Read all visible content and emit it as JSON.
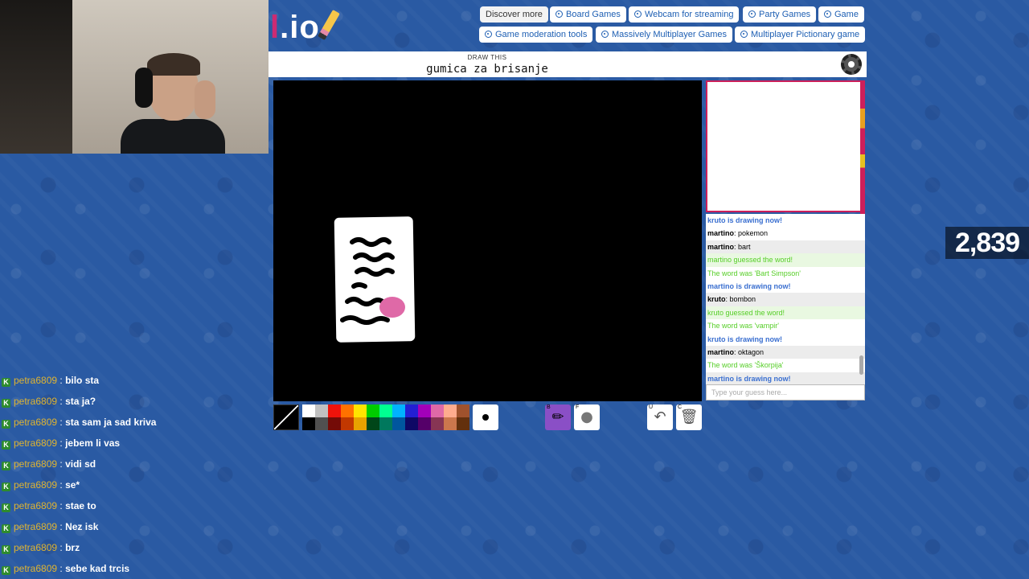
{
  "logo": {
    "part1": "l",
    "part2": ".io"
  },
  "top_links": [
    {
      "label": "Discover more"
    },
    {
      "label": "Board Games"
    },
    {
      "label": "Webcam for streaming"
    },
    {
      "label": "Party Games"
    },
    {
      "label": "Game"
    },
    {
      "label": "Game moderation tools"
    },
    {
      "label": "Massively Multiplayer Games"
    },
    {
      "label": "Multiplayer Pictionary game"
    }
  ],
  "header": {
    "draw_this_label": "DRAW THIS",
    "word": "gumica za brisanje"
  },
  "score": "2,839",
  "chat": {
    "messages": [
      {
        "text": "kruto is drawing now!",
        "kind": "blue"
      },
      {
        "user": "martino",
        "text": " pokemon",
        "kind": "msg"
      },
      {
        "user": "martino",
        "text": " bart",
        "kind": "msg"
      },
      {
        "text": "martino guessed the word!",
        "kind": "green"
      },
      {
        "text": "The word was 'Bart Simpson'",
        "kind": "green"
      },
      {
        "text": "martino is drawing now!",
        "kind": "blue"
      },
      {
        "user": "kruto",
        "text": " bombon",
        "kind": "msg"
      },
      {
        "text": "kruto guessed the word!",
        "kind": "green"
      },
      {
        "text": "The word was 'vampir'",
        "kind": "green"
      },
      {
        "text": "kruto is drawing now!",
        "kind": "blue"
      },
      {
        "user": "martino",
        "text": " oktagon",
        "kind": "msg"
      },
      {
        "text": "The word was 'Škorpija'",
        "kind": "green"
      },
      {
        "text": "martino is drawing now!",
        "kind": "blue"
      }
    ],
    "guess_placeholder": "Type your guess here..."
  },
  "tools": {
    "pen_key": "B",
    "fill_key": "F",
    "undo_key": "U",
    "clear_key": "C",
    "pen_icon": "pencil-icon",
    "fill_icon": "bucket-icon",
    "undo_icon": "undo-icon",
    "clear_icon": "trash-icon"
  },
  "palette": {
    "row1": [
      "#ffffff",
      "#c1c1c1",
      "#ef130b",
      "#ff7100",
      "#ffe400",
      "#00cc00",
      "#00ff91",
      "#00b2ff",
      "#231fd3",
      "#a300ba",
      "#df69a7",
      "#ffac8e",
      "#a0522d"
    ],
    "row2": [
      "#000000",
      "#505050",
      "#740b07",
      "#c23800",
      "#e8a200",
      "#004619",
      "#00785d",
      "#00569e",
      "#0e0865",
      "#550069",
      "#873554",
      "#cc774d",
      "#63300d"
    ]
  },
  "twitch_chat": [
    {
      "badge": "K",
      "user": "petra6809",
      "text": "bilo sta"
    },
    {
      "badge": "K",
      "user": "petra6809",
      "text": "sta ja?"
    },
    {
      "badge": "K",
      "user": "petra6809",
      "text": "sta sam ja sad kriva"
    },
    {
      "badge": "K",
      "user": "petra6809",
      "text": "jebem li vas"
    },
    {
      "badge": "K",
      "user": "petra6809",
      "text": "vidi sd"
    },
    {
      "badge": "K",
      "user": "petra6809",
      "text": "se*"
    },
    {
      "badge": "K",
      "user": "petra6809",
      "text": "stae to"
    },
    {
      "badge": "K",
      "user": "petra6809",
      "text": "Nez isk"
    },
    {
      "badge": "K",
      "user": "petra6809",
      "text": "brz"
    },
    {
      "badge": "K",
      "user": "petra6809",
      "text": "sebe kad trcis"
    }
  ]
}
